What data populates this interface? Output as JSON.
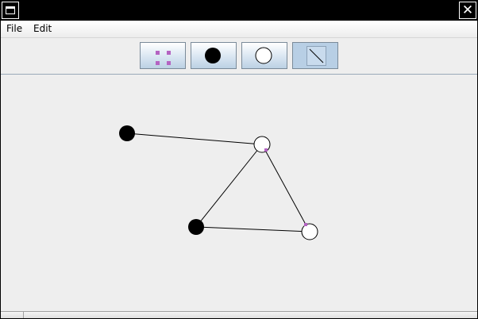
{
  "window": {
    "title": "",
    "controls": {
      "system_menu_icon": "window-icon",
      "close_icon": "close-icon",
      "close_glyph": "✕"
    }
  },
  "menubar": {
    "items": [
      {
        "label": "File"
      },
      {
        "label": "Edit"
      }
    ]
  },
  "toolbar": {
    "tools": [
      {
        "icon": "select-tool-icon",
        "selected": false
      },
      {
        "icon": "filled-node-icon",
        "selected": false
      },
      {
        "icon": "hollow-node-icon",
        "selected": false
      },
      {
        "icon": "edge-tool-icon",
        "selected": true
      }
    ]
  },
  "colors": {
    "titlebar": "#000000",
    "canvas_bg": "#eeeeee",
    "node_filled": "#000000",
    "node_hollow": "#ffffff",
    "selection_handle": "#b463c2",
    "edge": "#000000",
    "tool_selected_bg": "#b8cfe5"
  }
}
